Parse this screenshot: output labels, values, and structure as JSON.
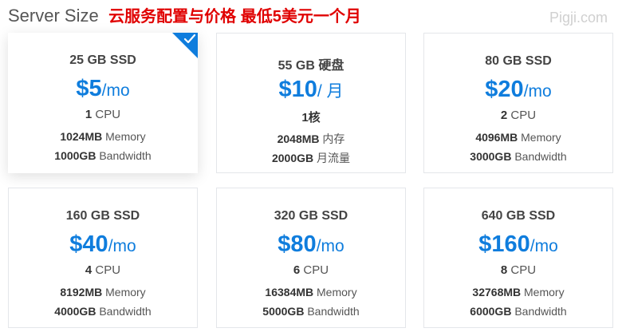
{
  "header": {
    "title": "Server Size",
    "annotation": "云服务配置与价格  最低5美元一个月",
    "watermark": "Pigji.com"
  },
  "colors": {
    "accent": "#0f7ddd",
    "annotation": "#e00000"
  },
  "plans": [
    {
      "storage": "25 GB SSD",
      "price": "$5",
      "period": "/mo",
      "cpu_num": "1",
      "cpu_label": " CPU",
      "mem_num": "1024MB",
      "mem_label": " Memory",
      "bw_num": "1000GB",
      "bw_label": " Bandwidth",
      "selected": true
    },
    {
      "storage": "55 GB  硬盘",
      "price": "$10",
      "period": "/ 月",
      "cpu_num": "1核",
      "cpu_label": "",
      "mem_num": "2048MB",
      "mem_label": "  内存",
      "bw_num": "2000GB",
      "bw_label": "  月流量",
      "selected": false
    },
    {
      "storage": "80 GB SSD",
      "price": "$20",
      "period": "/mo",
      "cpu_num": "2",
      "cpu_label": " CPU",
      "mem_num": "4096MB",
      "mem_label": " Memory",
      "bw_num": "3000GB",
      "bw_label": " Bandwidth",
      "selected": false
    },
    {
      "storage": "160 GB SSD",
      "price": "$40",
      "period": "/mo",
      "cpu_num": "4",
      "cpu_label": " CPU",
      "mem_num": "8192MB",
      "mem_label": " Memory",
      "bw_num": "4000GB",
      "bw_label": " Bandwidth",
      "selected": false
    },
    {
      "storage": "320 GB SSD",
      "price": "$80",
      "period": "/mo",
      "cpu_num": "6",
      "cpu_label": " CPU",
      "mem_num": "16384MB",
      "mem_label": " Memory",
      "bw_num": "5000GB",
      "bw_label": " Bandwidth",
      "selected": false
    },
    {
      "storage": "640 GB SSD",
      "price": "$160",
      "period": "/mo",
      "cpu_num": "8",
      "cpu_label": " CPU",
      "mem_num": "32768MB",
      "mem_label": " Memory",
      "bw_num": "6000GB",
      "bw_label": " Bandwidth",
      "selected": false
    }
  ]
}
